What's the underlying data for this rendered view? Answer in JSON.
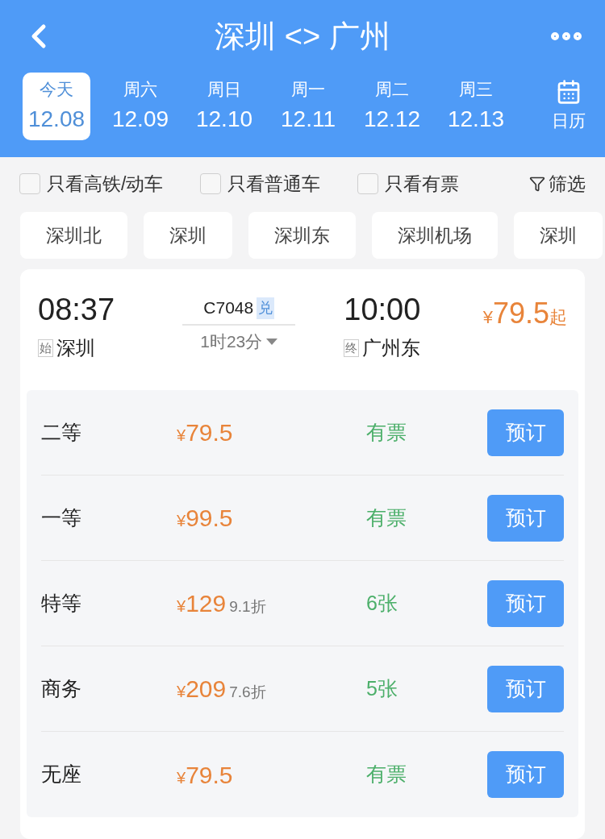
{
  "header": {
    "title": "深圳 <> 广州"
  },
  "dates": [
    {
      "weekday": "今天",
      "date": "12.08",
      "selected": true
    },
    {
      "weekday": "周六",
      "date": "12.09",
      "selected": false
    },
    {
      "weekday": "周日",
      "date": "12.10",
      "selected": false
    },
    {
      "weekday": "周一",
      "date": "12.11",
      "selected": false
    },
    {
      "weekday": "周二",
      "date": "12.12",
      "selected": false
    },
    {
      "weekday": "周三",
      "date": "12.13",
      "selected": false
    }
  ],
  "calendar_label": "日历",
  "filters": [
    {
      "label": "只看高铁/动车",
      "checked": false
    },
    {
      "label": "只看普通车",
      "checked": false
    },
    {
      "label": "只看有票",
      "checked": false
    }
  ],
  "filter_button": "筛选",
  "stations": [
    {
      "label": "深圳北"
    },
    {
      "label": "深圳"
    },
    {
      "label": "深圳东"
    },
    {
      "label": "深圳机场"
    },
    {
      "label": "深圳"
    }
  ],
  "train": {
    "depart_time": "08:37",
    "depart_tag": "始",
    "depart_station": "深圳",
    "number": "C7048",
    "badge": "兑",
    "duration": "1时23分",
    "arrive_time": "10:00",
    "arrive_tag": "终",
    "arrive_station": "广州东",
    "price_currency": "¥",
    "price": "79.5",
    "price_suffix": "起"
  },
  "seats": [
    {
      "name": "二等",
      "currency": "¥",
      "price": "79.5",
      "availability": "有票",
      "button": "预订"
    },
    {
      "name": "一等",
      "currency": "¥",
      "price": "99.5",
      "availability": "有票",
      "button": "预订"
    },
    {
      "name": "特等",
      "currency": "¥",
      "price": "129",
      "discount": "9.1折",
      "availability": "6张",
      "button": "预订"
    },
    {
      "name": "商务",
      "currency": "¥",
      "price": "209",
      "discount": "7.6折",
      "availability": "5张",
      "button": "预订"
    },
    {
      "name": "无座",
      "currency": "¥",
      "price": "79.5",
      "availability": "有票",
      "button": "预订"
    }
  ]
}
